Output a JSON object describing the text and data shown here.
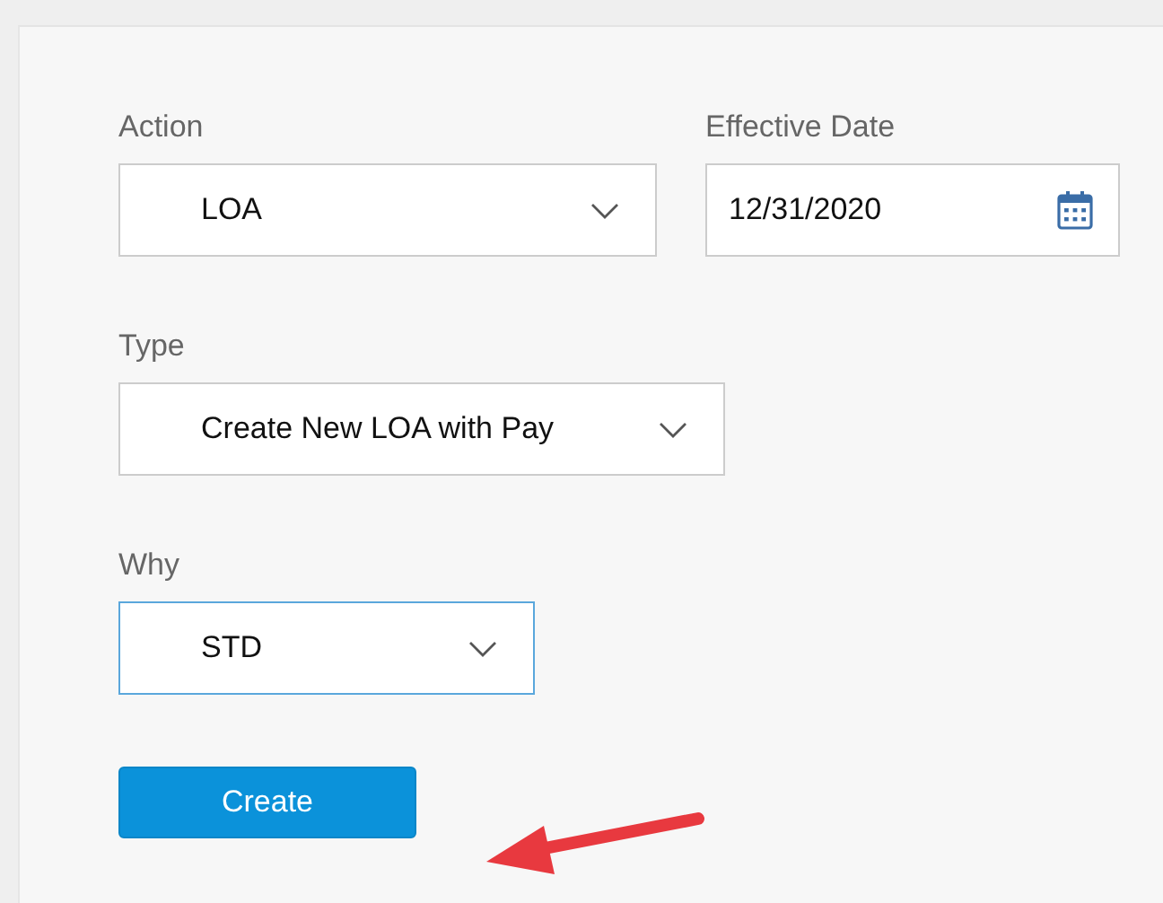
{
  "form": {
    "fields": [
      {
        "label": "Action",
        "kind": "select",
        "value": "LOA",
        "focused": false
      },
      {
        "label": "Effective Date",
        "kind": "date",
        "value": "12/31/2020",
        "focused": false
      },
      {
        "label": "Type",
        "kind": "select",
        "value": "Create New LOA with Pay",
        "focused": false
      },
      {
        "label": "Why",
        "kind": "select",
        "value": "STD",
        "focused": true
      }
    ],
    "submit_button": "Create"
  }
}
